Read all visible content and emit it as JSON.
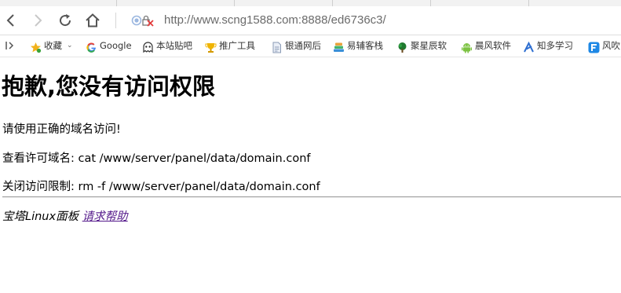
{
  "browser": {
    "address_url": "http://www.scng1588.com:8888/ed6736c3/",
    "bookmarks": [
      {
        "label": "收藏",
        "icon": "star-icon"
      },
      {
        "label": "Google",
        "icon": "google-icon"
      },
      {
        "label": "本站贴吧",
        "icon": "ghost-icon"
      },
      {
        "label": "推广工具",
        "icon": "trophy-icon"
      },
      {
        "label": "银通网后",
        "icon": "document-icon"
      },
      {
        "label": "易辅客栈",
        "icon": "books-icon"
      },
      {
        "label": "聚星辰软",
        "icon": "tree-icon"
      },
      {
        "label": "晨风软件",
        "icon": "android-icon"
      },
      {
        "label": "知多学习",
        "icon": "zhi-icon"
      },
      {
        "label": "风吹",
        "icon": "f-logo-icon"
      }
    ]
  },
  "content": {
    "heading": "抱歉,您没有访问权限",
    "line1": "请使用正确的域名访问!",
    "line2": "查看许可域名: cat /www/server/panel/data/domain.conf",
    "line3": "关闭访问限制: rm -f /www/server/panel/data/domain.conf",
    "footer_text": "宝塔Linux面板 ",
    "footer_link": "请求帮助"
  },
  "colors": {
    "link": "#551a8b",
    "url_text": "#6b6b6b",
    "toolbar_bg": "#ffffff"
  }
}
